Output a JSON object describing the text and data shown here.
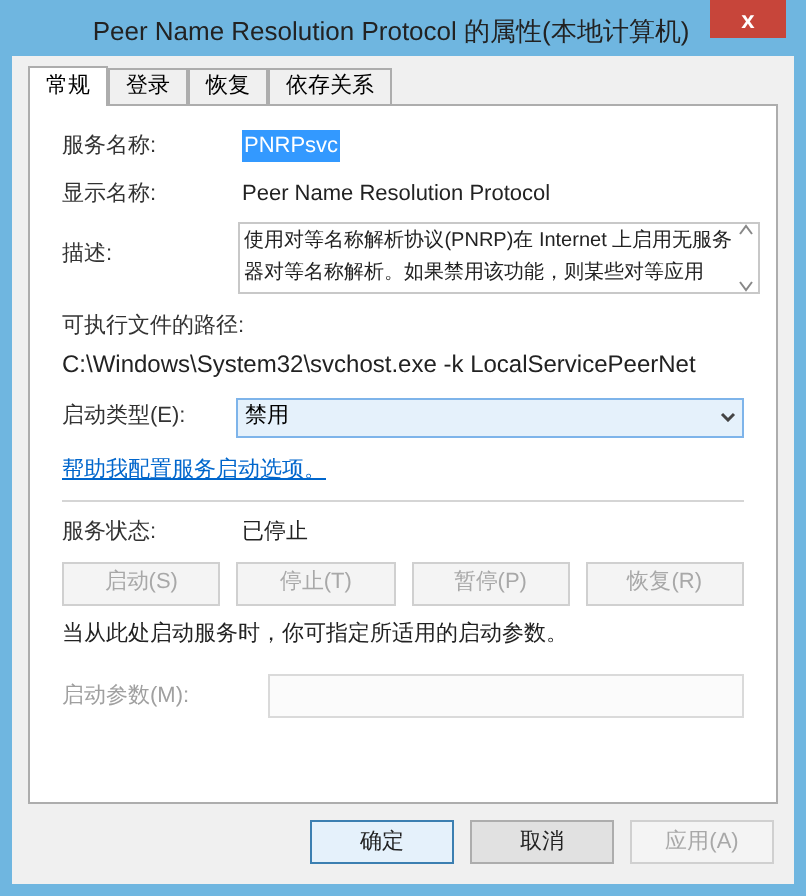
{
  "window": {
    "title": "Peer Name Resolution Protocol 的属性(本地计算机)",
    "close": "x"
  },
  "tabs": [
    {
      "label": "常规",
      "selected": true
    },
    {
      "label": "登录",
      "selected": false
    },
    {
      "label": "恢复",
      "selected": false
    },
    {
      "label": "依存关系",
      "selected": false
    }
  ],
  "service_name": {
    "label": "服务名称:",
    "value": "PNRPsvc"
  },
  "display_name": {
    "label": "显示名称:",
    "value": "Peer Name Resolution Protocol"
  },
  "description": {
    "label": "描述:",
    "value": "使用对等名称解析协议(PNRP)在 Internet 上启用无服务器对等名称解析。如果禁用该功能，则某些对等应用"
  },
  "executable_path": {
    "label": "可执行文件的路径:",
    "value": "C:\\Windows\\System32\\svchost.exe -k LocalServicePeerNet"
  },
  "startup_type": {
    "label": "启动类型(E):",
    "value": "禁用"
  },
  "help_link": "帮助我配置服务启动选项。",
  "service_status": {
    "label": "服务状态:",
    "value": "已停止"
  },
  "service_buttons": [
    {
      "label": "启动(S)",
      "disabled": true
    },
    {
      "label": "停止(T)",
      "disabled": true
    },
    {
      "label": "暂停(P)",
      "disabled": true
    },
    {
      "label": "恢复(R)",
      "disabled": true
    }
  ],
  "start_hint": "当从此处启动服务时，你可指定所适用的启动参数。",
  "start_parameters": {
    "label": "启动参数(M):",
    "disabled": true
  },
  "dialog_buttons": [
    {
      "label": "确定",
      "disabled": false
    },
    {
      "label": "取消",
      "disabled": false
    },
    {
      "label": "应用(A)",
      "disabled": true
    }
  ]
}
